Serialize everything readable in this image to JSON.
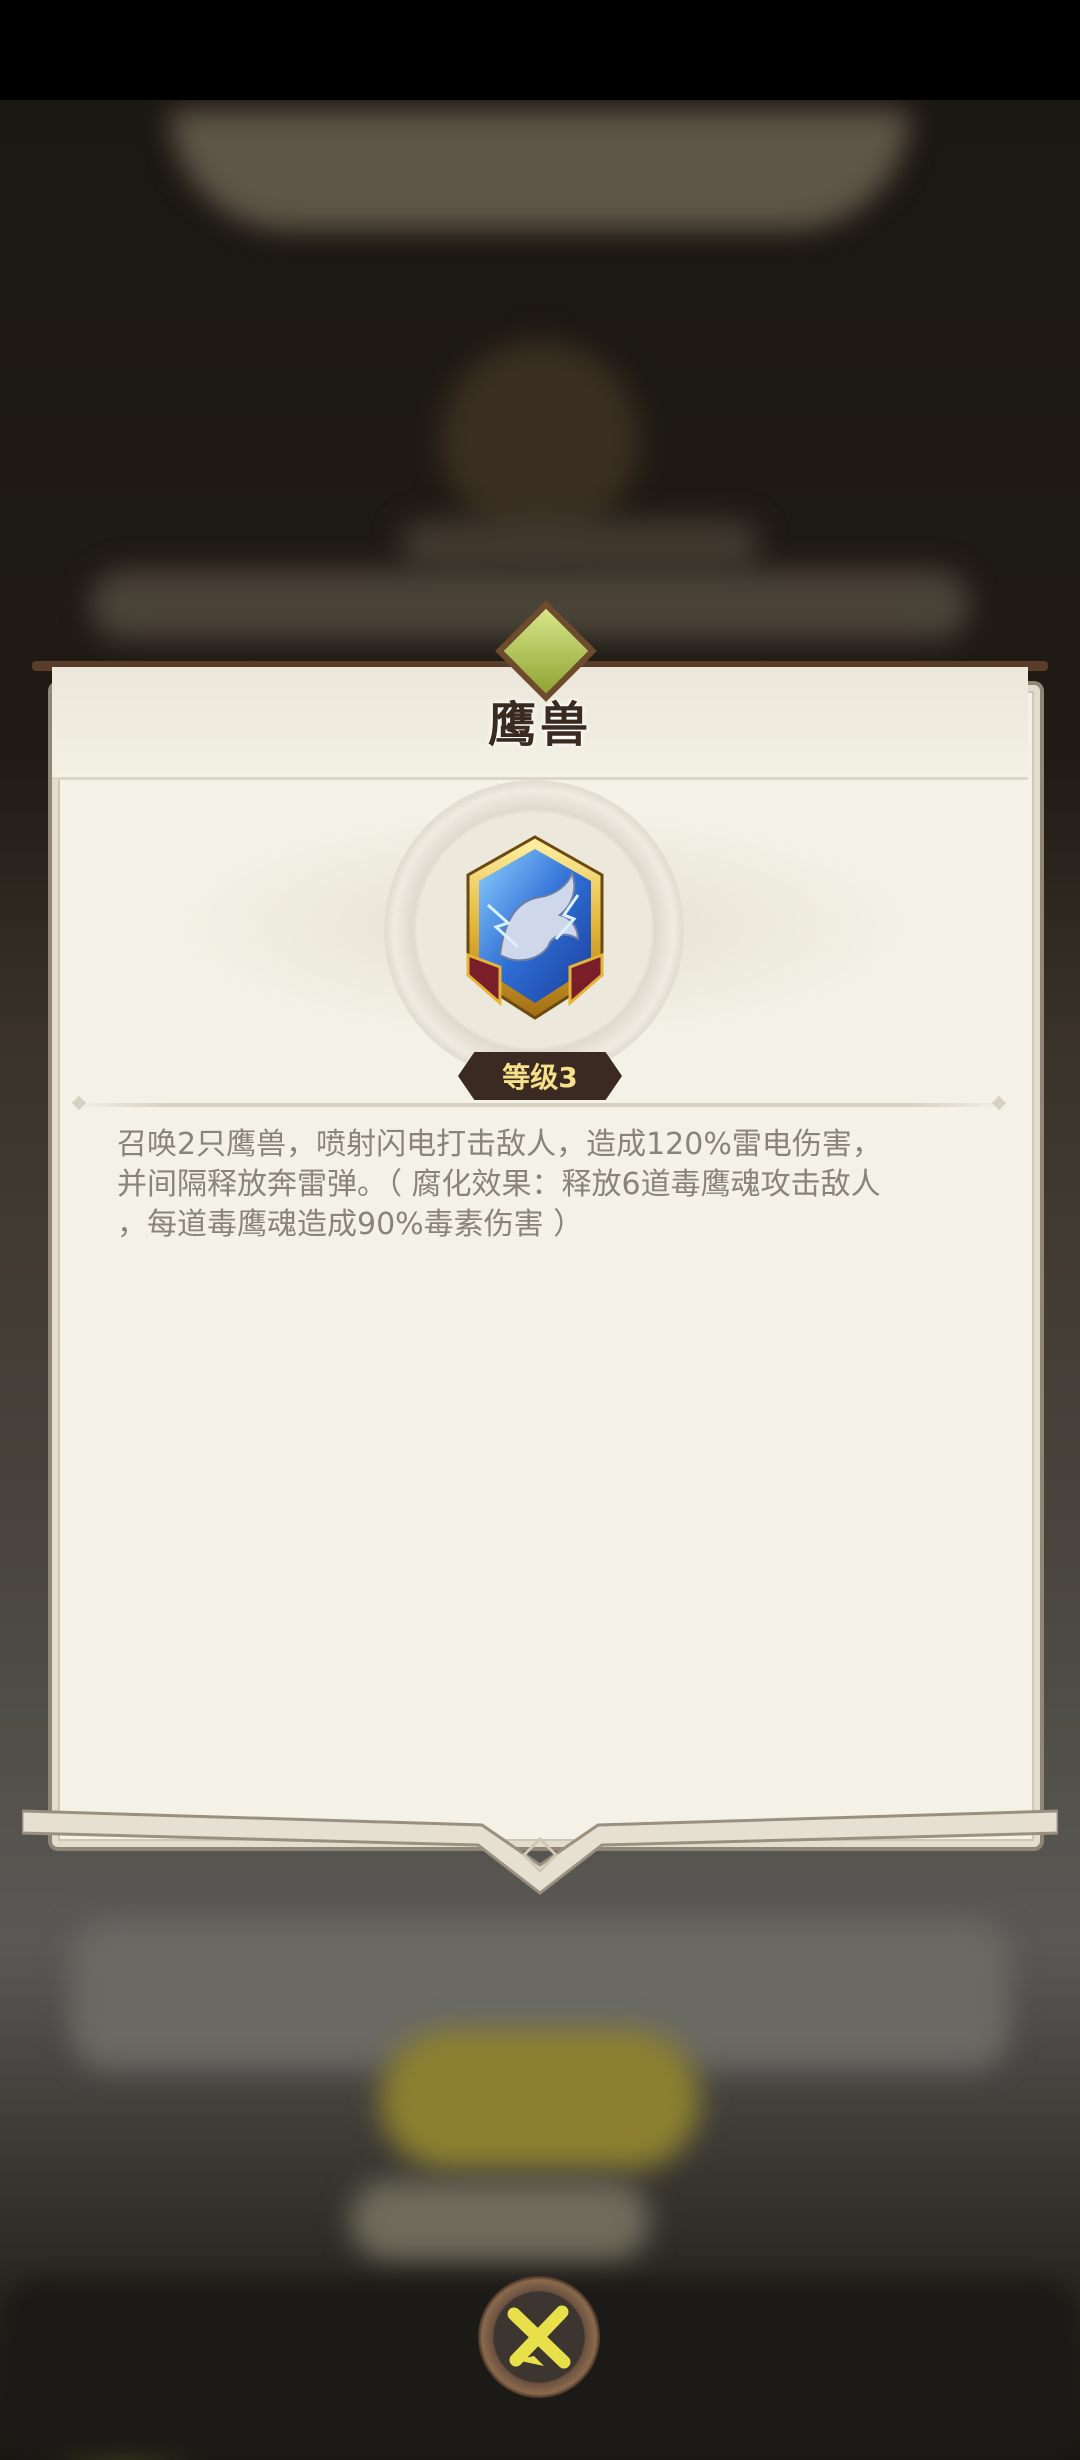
{
  "dialog": {
    "title": "鹰兽",
    "level_badge": "等级3",
    "description_lines": [
      "召唤2只鹰兽，喷射闪电打击敌人，造成120%雷电伤害，",
      "并间隔释放奔雷弹。（ 腐化效果：释放6道毒鹰魂攻击敌人",
      "，每道毒鹰魂造成90%毒素伤害 ）"
    ]
  },
  "colors": {
    "panel_background": "#f4f1e6",
    "title_text": "#3a2a1f",
    "description_text": "#8a837a",
    "level_badge_text": "#f7e08a",
    "close_icon": "#e8e04a"
  },
  "icons": {
    "skill": "griffin-skill-icon",
    "close": "close-x-icon",
    "gem": "green-gem-icon"
  }
}
